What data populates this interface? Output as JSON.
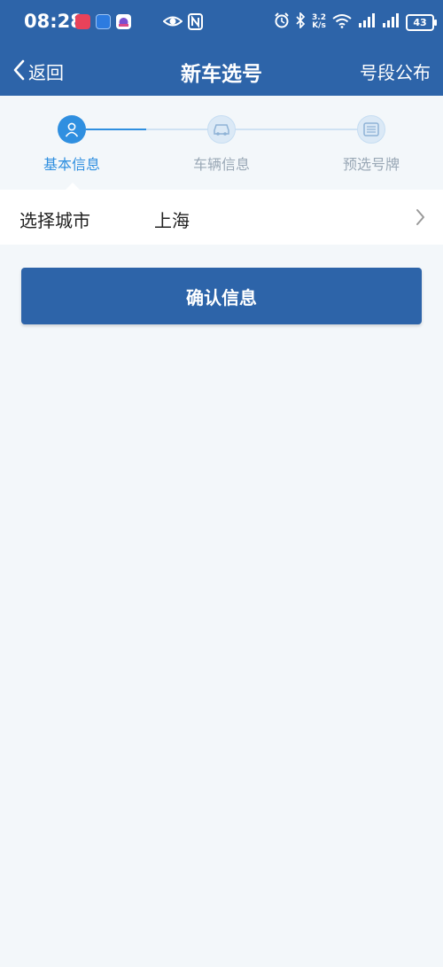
{
  "status_bar": {
    "time": "08:28",
    "net_speed_value": "3.2",
    "net_speed_unit": "K/s",
    "battery": "43",
    "icons": [
      "app-icon-red",
      "app-icon-blue",
      "app-icon-game",
      "eye-icon",
      "nfc-icon",
      "alarm-icon",
      "bluetooth-icon",
      "wifi-icon",
      "signal-icon",
      "signal-icon",
      "battery-icon"
    ]
  },
  "nav": {
    "back_label": "返回",
    "title": "新车选号",
    "right_label": "号段公布"
  },
  "steps": [
    {
      "label": "基本信息",
      "icon": "user-icon",
      "active": true
    },
    {
      "label": "车辆信息",
      "icon": "car-icon",
      "active": false
    },
    {
      "label": "预选号牌",
      "icon": "plate-icon",
      "active": false
    }
  ],
  "form": {
    "city_label": "选择城市",
    "city_value": "上海"
  },
  "confirm_label": "确认信息",
  "colors": {
    "primary": "#2d64a9",
    "step_active": "#2f8fe0",
    "step_inactive_bg": "#dbe9f6",
    "step_active_text": "#2f8fe0",
    "step_inactive_text": "#9aa8b6",
    "page_bg": "#f3f7fa"
  }
}
